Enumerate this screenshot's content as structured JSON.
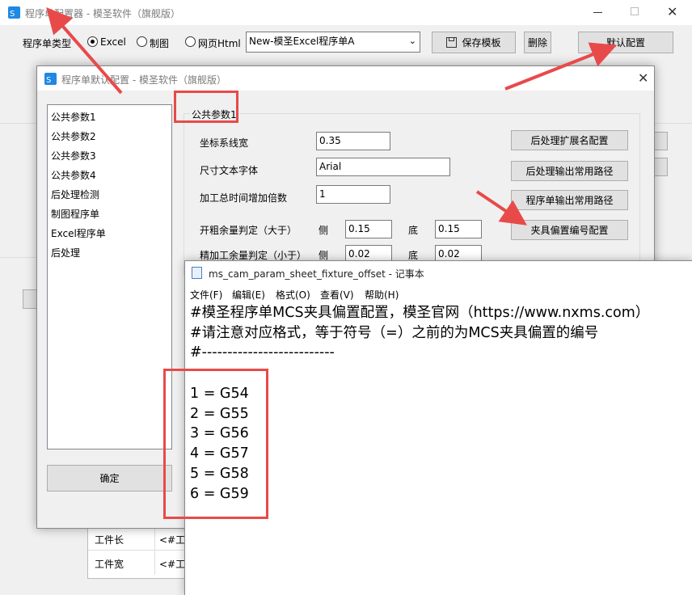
{
  "main_window": {
    "title": "程序单配置器 - 模圣软件（旗舰版）",
    "type_label": "程序单类型",
    "radio_excel": "Excel",
    "radio_drawing": "制图",
    "radio_html": "网页Html",
    "template_select": "New-模圣Excel程序单A",
    "save_template": "保存模板",
    "delete": "删除",
    "default_config": "默认配置",
    "table_row1_label": "工件长",
    "table_row1_value": "<#工",
    "table_row2_label": "工件宽",
    "table_row2_value": "<#工"
  },
  "dialog": {
    "title": "程序单默认配置 - 模圣软件（旗舰版）",
    "list_items": [
      "公共参数1",
      "公共参数2",
      "公共参数3",
      "公共参数4",
      "后处理检测",
      "制图程序单",
      "Excel程序单",
      "后处理"
    ],
    "ok_button": "确定",
    "group_title": "公共参数1",
    "coord_width_label": "坐标系线宽",
    "coord_width_value": "0.35",
    "dim_font_label": "尺寸文本字体",
    "dim_font_value": "Arial",
    "time_mult_label": "加工总时间增加倍数",
    "time_mult_value": "1",
    "rough_label": "开粗余量判定（大于）",
    "rough_side_label": "侧",
    "rough_side_value": "0.15",
    "rough_bottom_label": "底",
    "rough_bottom_value": "0.15",
    "finish_label": "精加工余量判定（小于）",
    "finish_side_label": "侧",
    "finish_side_value": "0.02",
    "finish_bottom_label": "底",
    "finish_bottom_value": "0.02",
    "btn_post_ext": "后处理扩展名配置",
    "btn_post_path": "后处理输出常用路径",
    "btn_sheet_path": "程序单输出常用路径",
    "btn_fixture": "夹具偏置编号配置"
  },
  "notepad": {
    "title": "ms_cam_param_sheet_fixture_offset - 记事本",
    "menu": [
      "文件(F)",
      "编辑(E)",
      "格式(O)",
      "查看(V)",
      "帮助(H)"
    ],
    "lines": [
      "#模圣程序单MCS夹具偏置配置，模圣官网（https://www.nxms.com）",
      "#请注意对应格式，等于符号（=）之前的为MCS夹具偏置的编号",
      "#--------------------------",
      "",
      "1 = G54",
      "2 = G55",
      "3 = G56",
      "4 = G57",
      "5 = G58",
      "6 = G59"
    ]
  },
  "colors": {
    "annotation_red": "#e84a4a",
    "logo_blue": "#1e88e5"
  }
}
